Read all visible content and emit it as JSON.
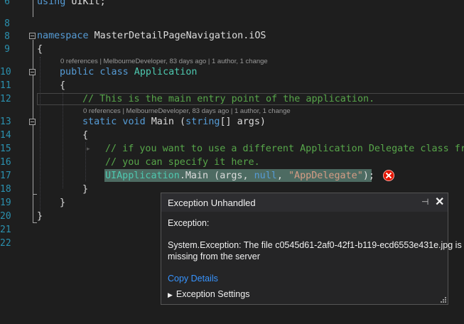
{
  "line_numbers": [
    "6",
    "7",
    "8",
    "9",
    "10",
    "11",
    "12",
    "13",
    "14",
    "15",
    "16",
    "17",
    "18",
    "19",
    "20",
    "21",
    "22"
  ],
  "code": {
    "l6_kw": "using",
    "l6_rest": " UIKit;",
    "l8_kw": "namespace",
    "l8_name": " MasterDetailPageNavigation.iOS",
    "l9": "{",
    "lens_app": "0 references | MelbourneDeveloper, 83 days ago | 1 author, 1 change",
    "l10_kw1": "public",
    "l10_kw2": " class",
    "l10_type": " Application",
    "l11": "{",
    "l12_comment": "// This is the main entry point of the application.",
    "lens_main": "0 references | MelbourneDeveloper, 83 days ago | 1 author, 1 change",
    "l13_kw1": "static",
    "l13_kw2": " void",
    "l13_name": " Main (",
    "l13_kw3": "string",
    "l13_rest": "[] args)",
    "l14": "{",
    "l15_comment": "// if you want to use a different Application Delegate class fr",
    "l16_comment": "// you can specify it here.",
    "l17_type": "UIApplication",
    "l17_mid": ".Main (args, ",
    "l17_kw": "null",
    "l17_comma": ", ",
    "l17_str": "\"AppDelegate\"",
    "l17_end": ");",
    "l18": "}",
    "l19": "}",
    "l20": "}"
  },
  "exception_popup": {
    "title": "Exception Unhandled",
    "label": "Exception:",
    "message_line1": "System.Exception: The file c0545d61-2af0-42f1-b119-ecd6553e431e.jpg is",
    "message_line2": "missing from the server",
    "copy_details": "Copy Details",
    "settings": "Exception Settings"
  },
  "colors": {
    "background": "#1e1e1e",
    "keyword": "#569cd6",
    "type": "#4ec9b0",
    "comment": "#57a64a",
    "string": "#d69d85",
    "link": "#3794ff",
    "error": "#e51400"
  },
  "icons": [
    "collapse-icon",
    "error-icon",
    "pin-icon",
    "close-icon",
    "expand-triangle-icon",
    "resize-grip-icon"
  ]
}
